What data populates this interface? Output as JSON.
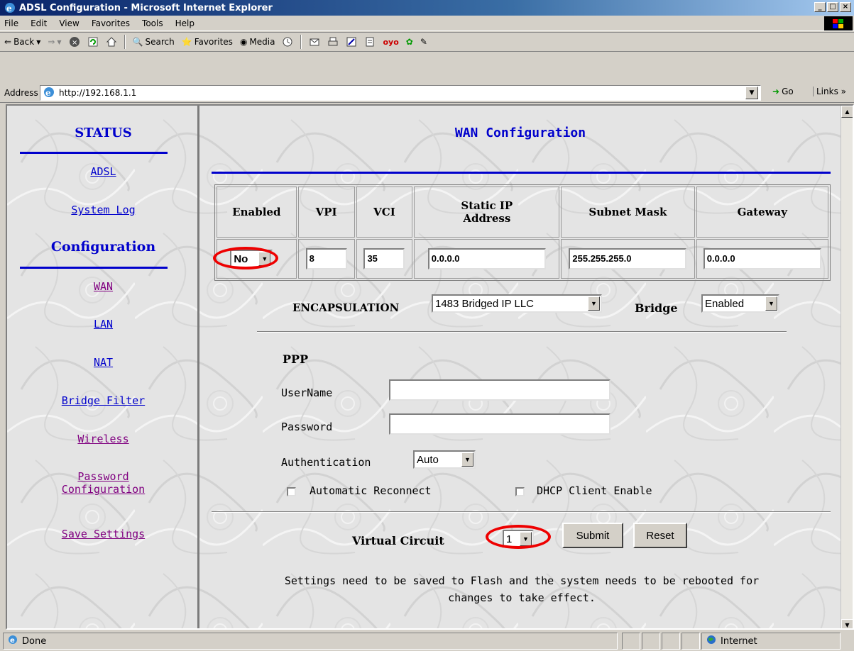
{
  "window": {
    "title": "ADSL Configuration - Microsoft Internet Explorer",
    "controls": [
      "_",
      "□",
      "×"
    ]
  },
  "menu": [
    "File",
    "Edit",
    "View",
    "Favorites",
    "Tools",
    "Help"
  ],
  "toolbar": {
    "back": "Back",
    "search": "Search",
    "favorites": "Favorites",
    "media": "Media"
  },
  "address": {
    "label": "Address",
    "url": "http://192.168.1.1",
    "go": "Go",
    "links": "Links"
  },
  "nav": {
    "status_title": "STATUS",
    "adsl": "ADSL",
    "system_log": "System Log",
    "config_title": "Configuration",
    "wan": "WAN",
    "lan": "LAN",
    "nat": "NAT",
    "bridge_filter": "Bridge Filter",
    "wireless": "Wireless",
    "password_config_1": "Password",
    "password_config_2": "Configuration",
    "save_settings": "Save Settings"
  },
  "main": {
    "title": "WAN Configuration",
    "headers": {
      "enabled": "Enabled",
      "vpi": "VPI",
      "vci": "VCI",
      "static_ip_1": "Static IP",
      "static_ip_2": "Address",
      "subnet": "Subnet Mask",
      "gateway": "Gateway"
    },
    "row": {
      "enabled": "No",
      "vpi": "8",
      "vci": "35",
      "static_ip": "0.0.0.0",
      "subnet": "255.255.255.0",
      "gateway": "0.0.0.0"
    },
    "encapsulation_label": "ENCAPSULATION",
    "encapsulation_value": "1483 Bridged IP LLC",
    "bridge_label": "Bridge",
    "bridge_value": "Enabled",
    "ppp_title": "PPP",
    "username_label": "UserName",
    "username_value": "",
    "password_label": "Password",
    "password_value": "",
    "auth_label": "Authentication",
    "auth_value": "Auto",
    "auto_reconnect": "Automatic Reconnect",
    "dhcp_client": "DHCP Client Enable",
    "vc_label": "Virtual Circuit",
    "vc_value": "1",
    "submit": "Submit",
    "reset": "Reset",
    "note_1": "Settings need to be saved to Flash and the system needs to be rebooted for",
    "note_2": "changes to take effect."
  },
  "status": {
    "text": "Done",
    "zone": "Internet"
  }
}
